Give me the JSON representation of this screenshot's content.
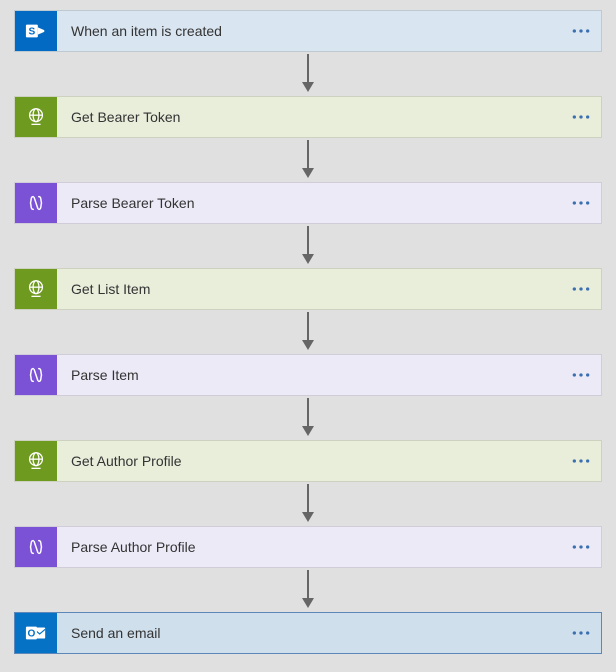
{
  "steps": [
    {
      "label": "When an item is created",
      "type": "sharepoint"
    },
    {
      "label": "Get Bearer Token",
      "type": "http"
    },
    {
      "label": "Parse Bearer Token",
      "type": "json"
    },
    {
      "label": "Get List Item",
      "type": "http"
    },
    {
      "label": "Parse Item",
      "type": "json"
    },
    {
      "label": "Get Author Profile",
      "type": "http"
    },
    {
      "label": "Parse Author Profile",
      "type": "json"
    },
    {
      "label": "Send an email",
      "type": "outlook"
    }
  ]
}
